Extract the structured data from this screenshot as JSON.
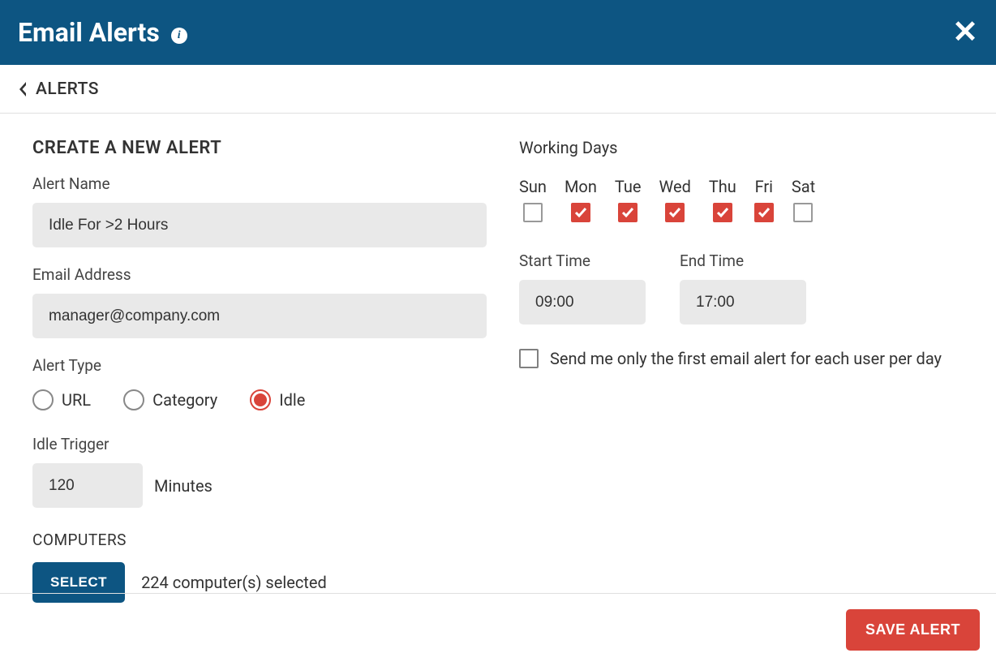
{
  "header": {
    "title": "Email Alerts"
  },
  "breadcrumb": {
    "label": "ALERTS"
  },
  "form": {
    "section_title": "CREATE A NEW ALERT",
    "alert_name_label": "Alert Name",
    "alert_name_value": "Idle For >2 Hours",
    "email_label": "Email Address",
    "email_value": "manager@company.com",
    "alert_type_label": "Alert Type",
    "alert_types": {
      "url": "URL",
      "category": "Category",
      "idle": "Idle",
      "selected": "idle"
    },
    "idle_trigger_label": "Idle Trigger",
    "idle_minutes_value": "120",
    "idle_minutes_suffix": "Minutes",
    "computers_label": "COMPUTERS",
    "select_button": "SELECT",
    "computers_selected": "224 computer(s) selected",
    "working_days_label": "Working Days",
    "days": [
      {
        "name": "Sun",
        "checked": false
      },
      {
        "name": "Mon",
        "checked": true
      },
      {
        "name": "Tue",
        "checked": true
      },
      {
        "name": "Wed",
        "checked": true
      },
      {
        "name": "Thu",
        "checked": true
      },
      {
        "name": "Fri",
        "checked": true
      },
      {
        "name": "Sat",
        "checked": false
      }
    ],
    "start_time_label": "Start Time",
    "start_time_value": "09:00",
    "end_time_label": "End Time",
    "end_time_value": "17:00",
    "first_only_checked": false,
    "first_only_label": "Send me only the first email alert for each user per day"
  },
  "footer": {
    "save_button": "SAVE ALERT"
  }
}
